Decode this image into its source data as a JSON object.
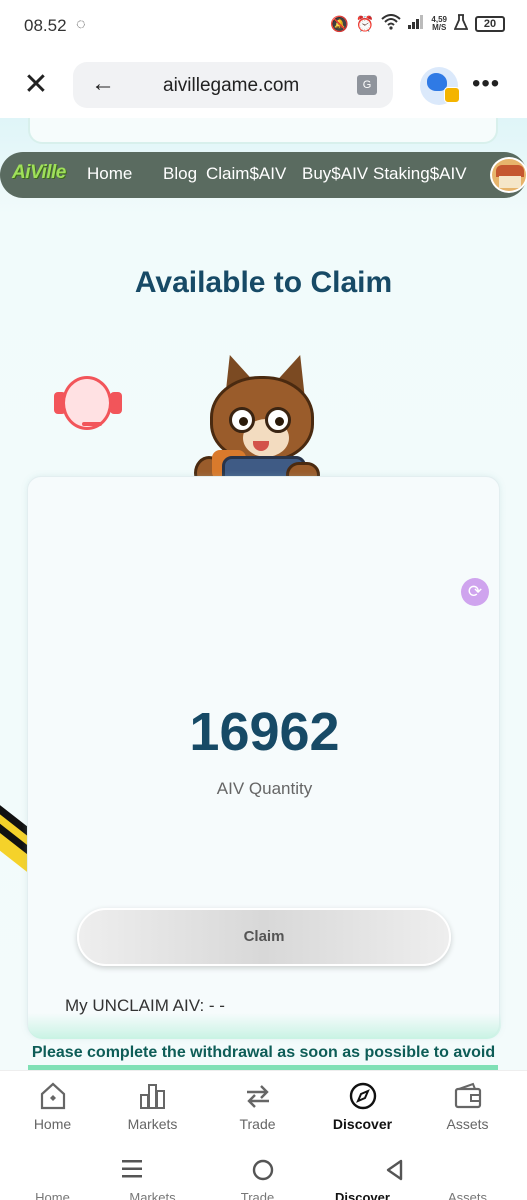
{
  "status_bar": {
    "time": "08.52",
    "speed_value": "4,59",
    "speed_unit": "M/S",
    "battery": "20"
  },
  "browser": {
    "url": "aivillegame.com"
  },
  "site_nav": {
    "logo": "AiVille",
    "links": [
      "Home",
      "Blog",
      "Claim$AIV",
      "Buy$AIV",
      "Staking$AIV"
    ]
  },
  "page": {
    "title": "Available to Claim",
    "amount": "16962",
    "amount_label": "AIV Quantity",
    "claim_button": "Claim",
    "unclaim_text": "My UNCLAIM AIV: - -",
    "notice": "Please complete the withdrawal as soon as possible to avoid"
  },
  "app_nav": {
    "tabs": [
      {
        "label": "Home",
        "icon": "home-icon"
      },
      {
        "label": "Markets",
        "icon": "bar-chart-icon"
      },
      {
        "label": "Trade",
        "icon": "swap-arrows-icon"
      },
      {
        "label": "Discover",
        "icon": "compass-icon"
      },
      {
        "label": "Assets",
        "icon": "wallet-icon"
      }
    ],
    "active_tab": "Discover"
  },
  "system_nav": {
    "buttons": [
      "recent-apps-icon",
      "home-circle-icon",
      "back-triangle-icon"
    ]
  },
  "colors": {
    "title": "#174a66",
    "nav_background": "#5a6b60",
    "logo_green": "#9fe05a",
    "notice": "#0e5d57",
    "support_red": "#f2555a",
    "refresh_purple": "#cfa4ee"
  }
}
